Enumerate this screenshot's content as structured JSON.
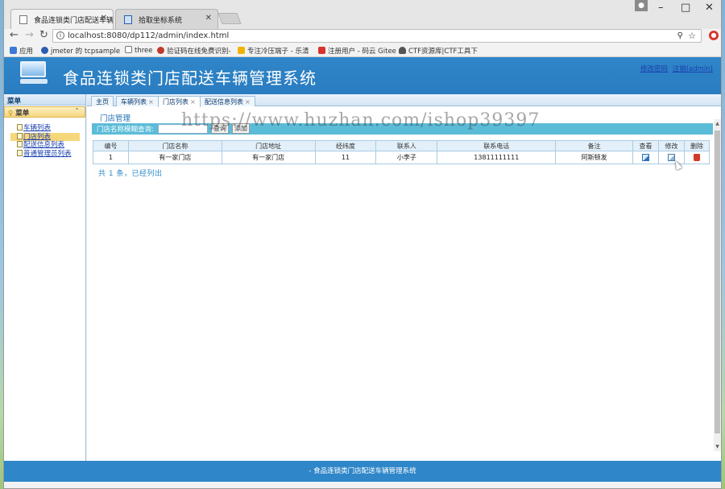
{
  "browser": {
    "tabs": [
      {
        "title": "食品连锁类门店配送车辆",
        "active": true
      },
      {
        "title": "拾取坐标系统",
        "active": false
      }
    ],
    "user_badge": "",
    "window_controls": {
      "minimize": "–",
      "maximize": "□",
      "close": "✕"
    },
    "url": "localhost:8080/dp112/admin/index.html",
    "bookmarks": [
      {
        "label": "应用",
        "icon_color": "#3c7ad6"
      },
      {
        "label": "jmeter 的 tcpsample",
        "icon_color": "#2a5db0"
      },
      {
        "label": "three",
        "icon_color": "#ffffff"
      },
      {
        "label": "验证码在线免费识别-",
        "icon_color": "#c0392b"
      },
      {
        "label": "专注冷压端子 - 乐清",
        "icon_color": "#f0b400"
      },
      {
        "label": "注册用户 - 码云 Gitee",
        "icon_color": "#d9342b"
      },
      {
        "label": "CTF资源库|CTF工具下",
        "icon_color": "#555555"
      }
    ]
  },
  "app": {
    "title": "食品连锁类门店配送车辆管理系统",
    "top_links": {
      "change_password": "修改密码",
      "logout": "注销(admin)"
    },
    "brand_color": "#2f86c8"
  },
  "sidebar": {
    "header": "菜单",
    "group": "菜单",
    "items": [
      {
        "label": "车辆列表",
        "active": false
      },
      {
        "label": "门店列表",
        "active": true
      },
      {
        "label": "配送信息列表",
        "active": false
      },
      {
        "label": "普通管理员列表",
        "active": false
      }
    ]
  },
  "content_tabs": [
    {
      "label": "主页",
      "closable": false,
      "active": false
    },
    {
      "label": "车辆列表",
      "closable": true,
      "active": false
    },
    {
      "label": "门店列表",
      "closable": true,
      "active": true
    },
    {
      "label": "配送信息列表",
      "closable": true,
      "active": false
    }
  ],
  "panel": {
    "title": "门店管理",
    "search_label": "门店名称模糊查询:",
    "search_value": "",
    "search_button": "查询",
    "add_button": "添加"
  },
  "table": {
    "columns": [
      "编号",
      "门店名称",
      "门店地址",
      "经纬度",
      "联系人",
      "联系电话",
      "备注",
      "查看",
      "修改",
      "删除"
    ],
    "rows": [
      {
        "id": "1",
        "name": "有一家门店",
        "address": "有一家门店",
        "coords": "11",
        "contact": "小李子",
        "phone": "13811111111",
        "remark": "阿斯顿发"
      }
    ],
    "action_icons": {
      "view": "view-icon",
      "edit": "edit-icon",
      "delete": "trash-icon"
    }
  },
  "summary": "共 1 条，已经列出",
  "footer": "- 食品连锁类门店配送车辆管理系统",
  "watermark": "https://www.huzhan.com/ishop39397"
}
